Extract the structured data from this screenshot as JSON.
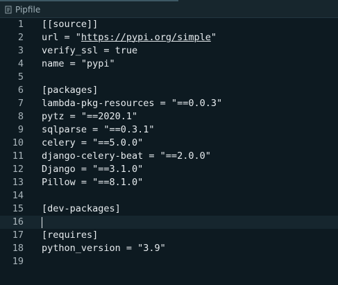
{
  "tab": {
    "title": "Pipfile",
    "icon": "file-icon"
  },
  "current_line": 16,
  "lines": [
    {
      "number": "1",
      "text": "[[source]]"
    },
    {
      "number": "2",
      "text_before": "url = \"",
      "link": "https://pypi.org/simple",
      "text_after": "\""
    },
    {
      "number": "3",
      "text": "verify_ssl = true"
    },
    {
      "number": "4",
      "text": "name = \"pypi\""
    },
    {
      "number": "5",
      "text": ""
    },
    {
      "number": "6",
      "text": "[packages]"
    },
    {
      "number": "7",
      "text": "lambda-pkg-resources = \"==0.0.3\""
    },
    {
      "number": "8",
      "text": "pytz = \"==2020.1\""
    },
    {
      "number": "9",
      "text": "sqlparse = \"==0.3.1\""
    },
    {
      "number": "10",
      "text": "celery = \"==5.0.0\""
    },
    {
      "number": "11",
      "text": "django-celery-beat = \"==2.0.0\""
    },
    {
      "number": "12",
      "text": "Django = \"==3.1.0\""
    },
    {
      "number": "13",
      "text": "Pillow = \"==8.1.0\""
    },
    {
      "number": "14",
      "text": ""
    },
    {
      "number": "15",
      "text": "[dev-packages]"
    },
    {
      "number": "16",
      "text": ""
    },
    {
      "number": "17",
      "text": "[requires]"
    },
    {
      "number": "18",
      "text": "python_version = \"3.9\""
    },
    {
      "number": "19",
      "text": ""
    }
  ]
}
